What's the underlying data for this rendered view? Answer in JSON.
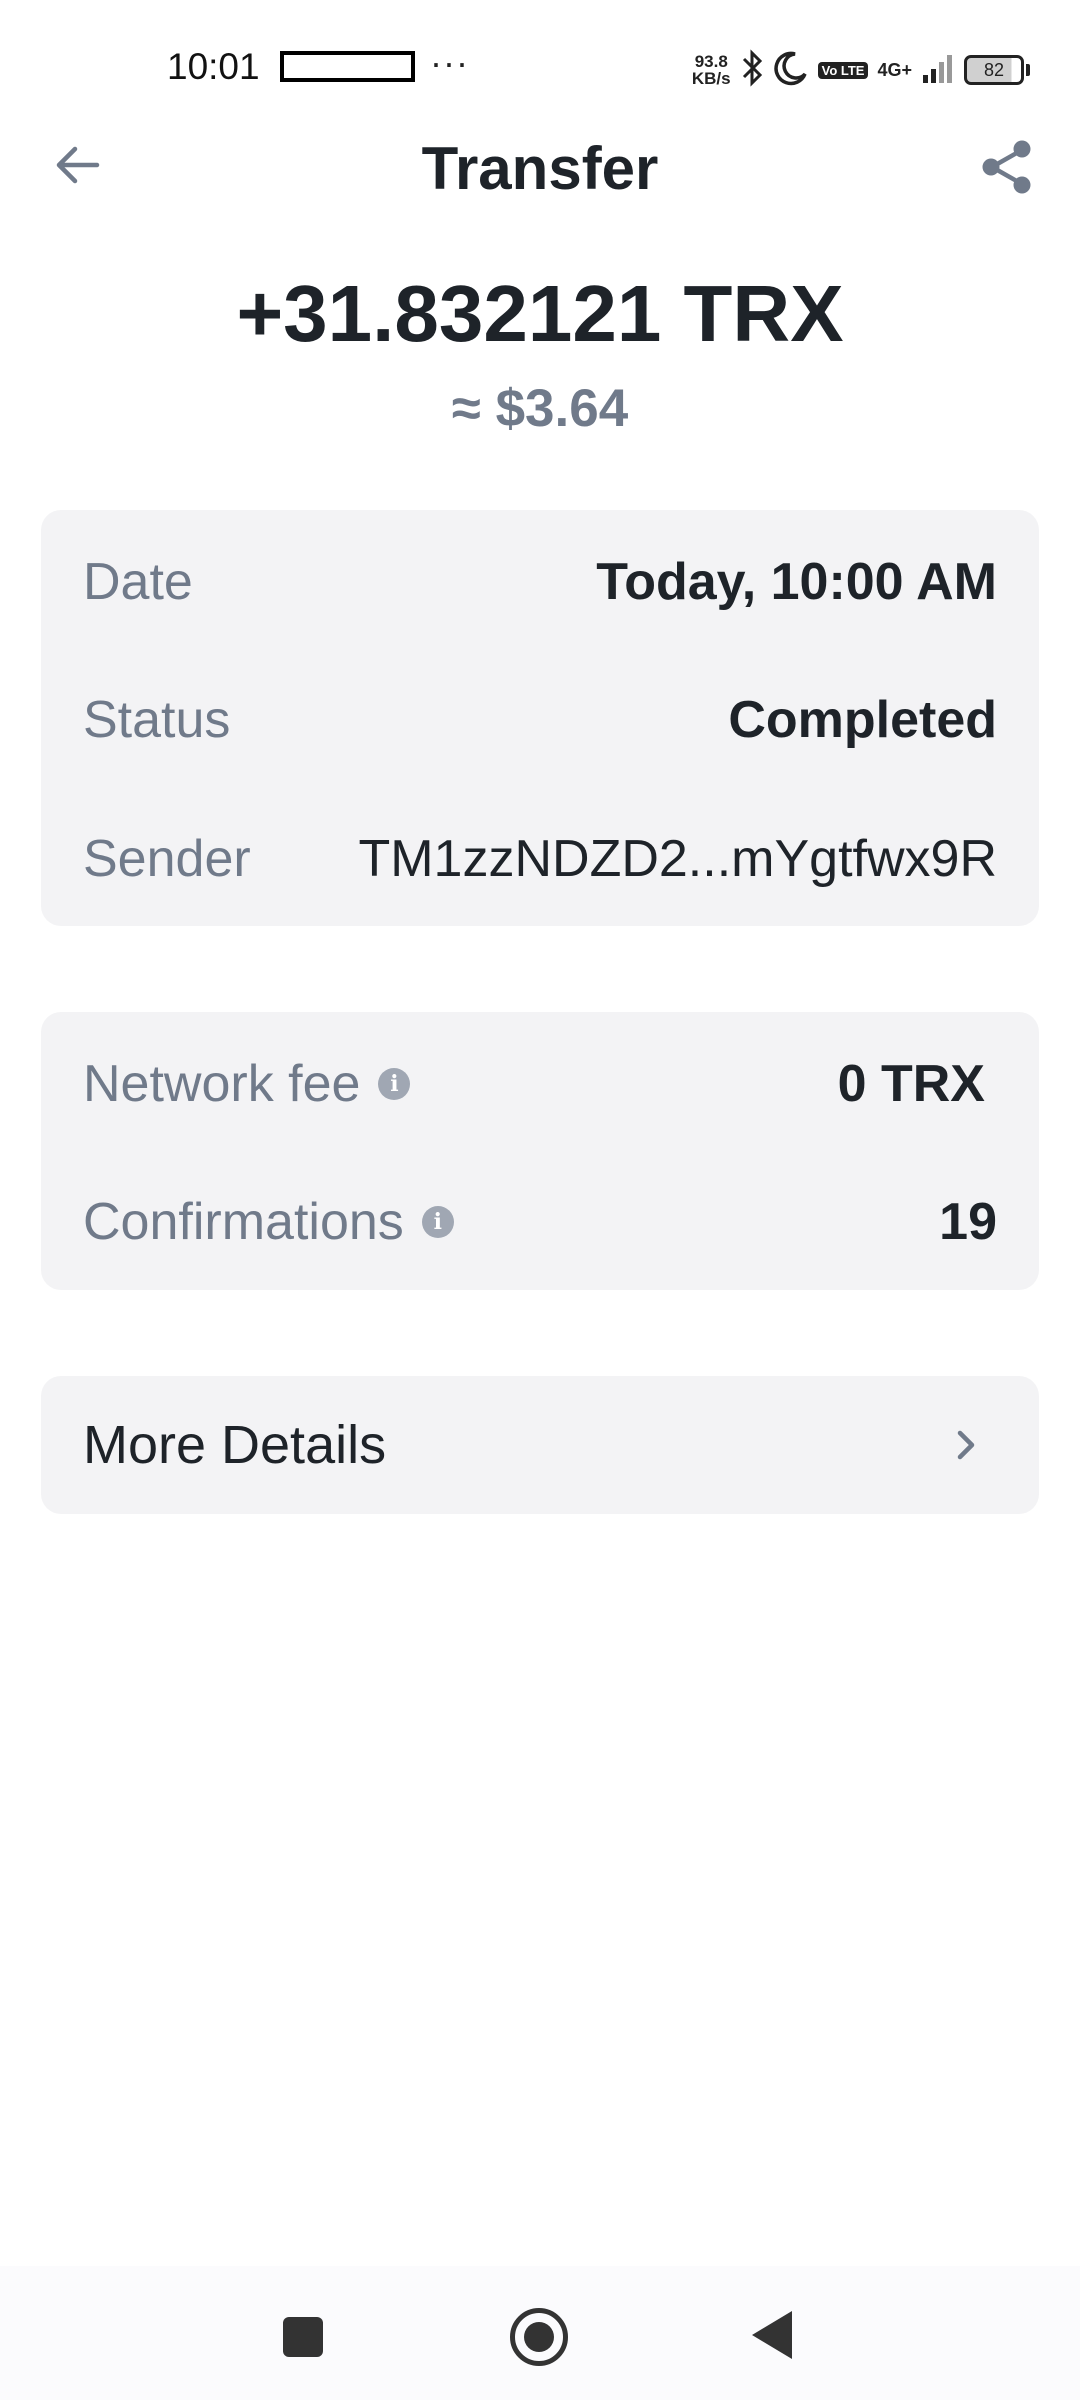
{
  "status_bar": {
    "time": "10:01",
    "dots": "···",
    "speed_value": "93.8",
    "speed_unit": "KB/s",
    "volte": "Vo LTE",
    "network": "4G+",
    "battery": "82",
    "icons": [
      "bluetooth-icon",
      "moon-icon",
      "signal-icon",
      "battery-icon"
    ]
  },
  "header": {
    "title": "Transfer",
    "back_icon": "arrow-left-icon",
    "share_icon": "share-icon"
  },
  "amount": {
    "value": "+31.832121 TRX",
    "fiat": "≈ $3.64"
  },
  "details": [
    {
      "label": "Date",
      "value": "Today, 10:00 AM"
    },
    {
      "label": "Status",
      "value": "Completed"
    },
    {
      "label": "Sender",
      "value": "TM1zzNDZD2...mYgtfwx9R"
    }
  ],
  "fees": [
    {
      "label": "Network fee",
      "value": "0 TRX",
      "info": "i"
    },
    {
      "label": "Confirmations",
      "value": "19",
      "info": "i"
    }
  ],
  "more_details": {
    "label": "More Details"
  },
  "colors": {
    "text_primary": "#1e2329",
    "text_secondary": "#707a8a",
    "card_bg": "#f3f3f5",
    "icon_gray": "#a0a7b3"
  }
}
